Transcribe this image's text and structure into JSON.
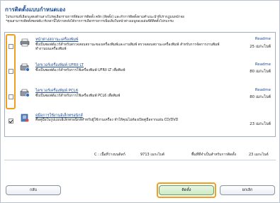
{
  "window": {
    "title": "การติดตั้งแบบกำหนดเอง",
    "intro_line1": "ไปรแกรมที่เลือกแสดงด้านล่างโปรดเลือกรายการที่ต้องการติดตั้ง คลิก [ติดตั้ง] และทำการติดตั้งตามคำแนะนำที่ปรากฏบนหน้าจอ",
    "intro_line2": "*คุณสามารถติดตั้งซอฟต์แวร์เหล่านี้ได้ภายหลังได้จากการเลือกรายการเพิ่มเติมในหน้าต่างเมนูของแผ่นซีดีติดตั้งโปรแกรม"
  },
  "items": [
    {
      "icon": "printer-icon",
      "name": "หน้าต่างสถานะเครื่องพิมพ์",
      "desc": "ซึ่งเป็นซอฟต์แวร์สำหรับตรวจสอบสถานะของเครื่องพิมพ์และงานพิมพ์ ตรวจสอบสถานะเครื่องพิมพ์ สำหรับการจัดการงานพิมพ์ ทำงานบนเครื่องพิมพ์",
      "readme": "Readme",
      "size": "25 เมกะไบต์",
      "checked": false
    },
    {
      "icon": "driver-icon",
      "name": "ไดรเวอร์เครื่องพิมพ์ UFRII LT",
      "desc": "ซึ่งเป็นซอฟต์แวร์สำหรับการใช้เครื่องพิมพ์ UFRII LT เพื่อพิมพ์",
      "readme": "Readme",
      "size": "80 เมกะไบต์",
      "checked": false
    },
    {
      "icon": "driver-icon",
      "name": "ไดรเวอร์เครื่องพิมพ์ PCL6",
      "desc": "ซึ่งเป็นซอฟต์แวร์สำหรับการใช้เครื่องพิมพ์ PCL6 เพื่อพิมพ์",
      "readme": "Readme",
      "size": "80 เมกะไบต์",
      "checked": false
    },
    {
      "icon": "manual-icon",
      "name": "คู่มือการใช้งานอิเล็กทรอนิกส์",
      "desc": "คือคู่มือในรูปแบบอิเล็กทรอนิกส์สำหรับผู้ใช้งานเครื่อง ทำให้คุณไม่ต้องเปิดคู่มือจากแผ่น CD/DVD",
      "readme": "",
      "size": "23 เมกะไบต์",
      "checked": true
    }
  ],
  "status": {
    "drive_label": "C : เนื้อที่ว่างบนดิสก์",
    "drive_free": "9713 เมกะไบต์",
    "required_label": "พื้นที่ที่จำเป็นสำหรับการติดตั้ง",
    "required_value": "23 เมกะไบต์"
  },
  "buttons": {
    "back": "กลับ",
    "install": "ติดตั้ง",
    "cancel": "ยกเลิก"
  },
  "colors": {
    "accent": "#1f4e96",
    "highlight": "#f0a020",
    "install_green": "#cde9c3"
  }
}
